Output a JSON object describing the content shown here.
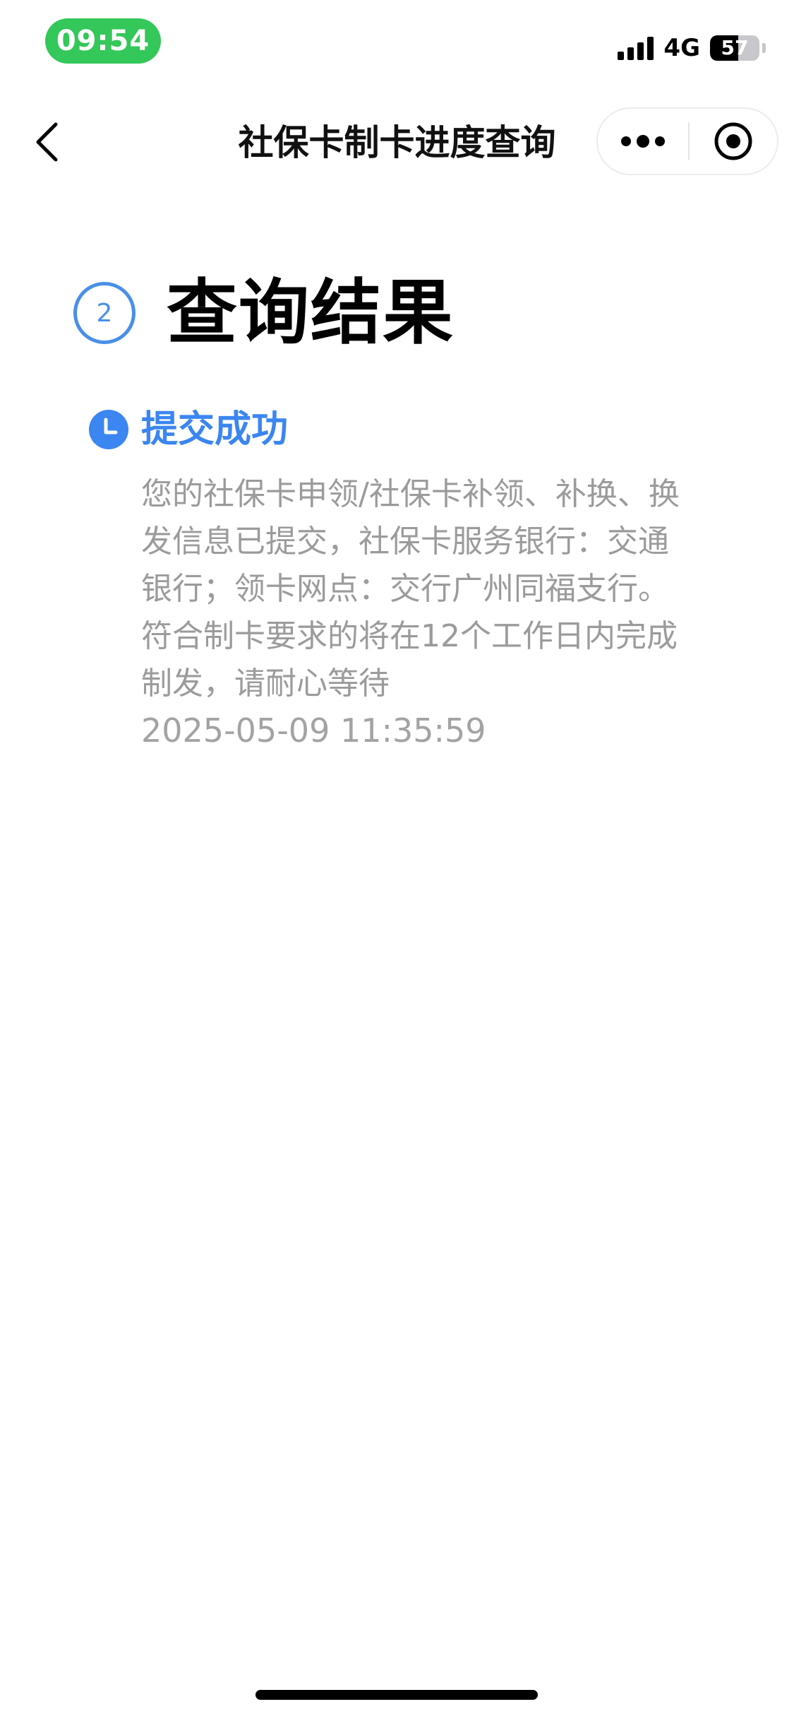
{
  "status_bar": {
    "time": "09:54",
    "network": "4G",
    "battery_level": "57",
    "battery_fraction": 0.57
  },
  "nav": {
    "title": "社保卡制卡进度查询"
  },
  "step": {
    "number": "2",
    "title": "查询结果"
  },
  "status_entry": {
    "title": "提交成功",
    "description": "您的社保卡申领/社保卡补领、补换、换发信息已提交，社保卡服务银行：交通银行；领卡网点：交行广州同福支行。符合制卡要求的将在12个工作日内完成制发，请耐心等待",
    "timestamp": "2025-05-09 11:35:59"
  },
  "colors": {
    "accent_blue": "#3b86f0",
    "step_badge_blue": "#4a8fe7",
    "time_pill_green": "#34c759",
    "muted_text": "#9b9b9b"
  },
  "icons": {
    "back": "chevron-left-icon",
    "more": "more-dots-icon",
    "close": "target-circle-icon",
    "status": "clock-icon"
  }
}
